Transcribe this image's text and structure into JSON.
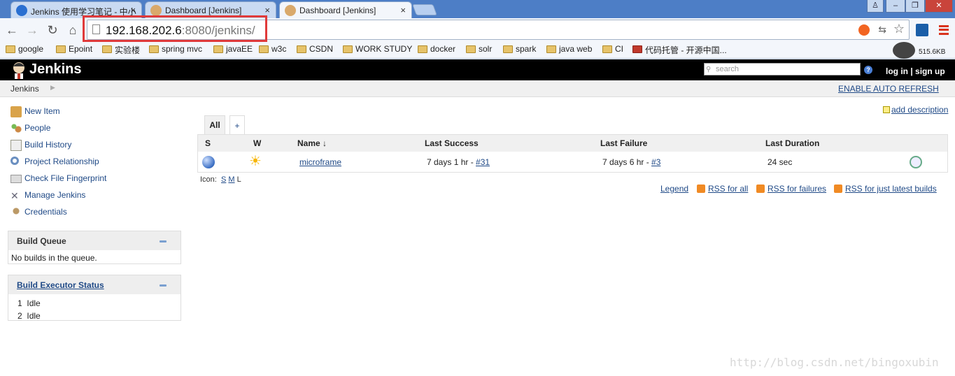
{
  "browser": {
    "tabs": [
      {
        "label": "Jenkins 使用学习笔记 - 中小",
        "active": false
      },
      {
        "label": "Dashboard [Jenkins]",
        "active": false
      },
      {
        "label": "Dashboard [Jenkins]",
        "active": true
      }
    ],
    "url_host": "192.168.202.6",
    "url_rest": ":8080/jenkins/",
    "bookmarks": [
      "google",
      "Epoint",
      "实验楼",
      "spring mvc",
      "javaEE",
      "w3c",
      "CSDN",
      "WORK STUDY",
      "docker",
      "solr",
      "spark",
      "java web",
      "CI",
      "代码托管 - 开源中国..."
    ],
    "net_speed": "515.6KB"
  },
  "header": {
    "title": "Jenkins",
    "search_placeholder": "search",
    "login": "log in",
    "signup": "sign up",
    "help": "?"
  },
  "breadcrumb": {
    "root": "Jenkins",
    "auto_refresh": "ENABLE AUTO REFRESH"
  },
  "sidebar": {
    "tasks": [
      "New Item",
      "People",
      "Build History",
      "Project Relationship",
      "Check File Fingerprint",
      "Manage Jenkins",
      "Credentials"
    ],
    "build_queue": {
      "title": "Build Queue",
      "empty": "No builds in the queue."
    },
    "executors": {
      "title": "Build Executor Status",
      "rows": [
        {
          "num": "1",
          "status": "Idle"
        },
        {
          "num": "2",
          "status": "Idle"
        }
      ]
    }
  },
  "main": {
    "add_description": "add description",
    "view_tab": "All",
    "add_tab": "+",
    "columns": [
      "S",
      "W",
      "Name ↓",
      "Last Success",
      "Last Failure",
      "Last Duration"
    ],
    "jobs": [
      {
        "name": "microframe",
        "last_success": "7 days 1 hr - ",
        "last_success_build": "#31",
        "last_failure": "7 days 6 hr - ",
        "last_failure_build": "#3",
        "last_duration": "24 sec"
      }
    ],
    "icon_label": "Icon:",
    "icon_sizes": [
      "S",
      "M",
      "L"
    ],
    "legend": "Legend",
    "rss": [
      "RSS for all",
      "RSS for failures",
      "RSS for just latest builds"
    ]
  },
  "watermark": "http://blog.csdn.net/bingoxubin",
  "colors": {
    "accent": "#204a87",
    "highlight_box": "#e03a3a",
    "header_bg": "#000000"
  }
}
